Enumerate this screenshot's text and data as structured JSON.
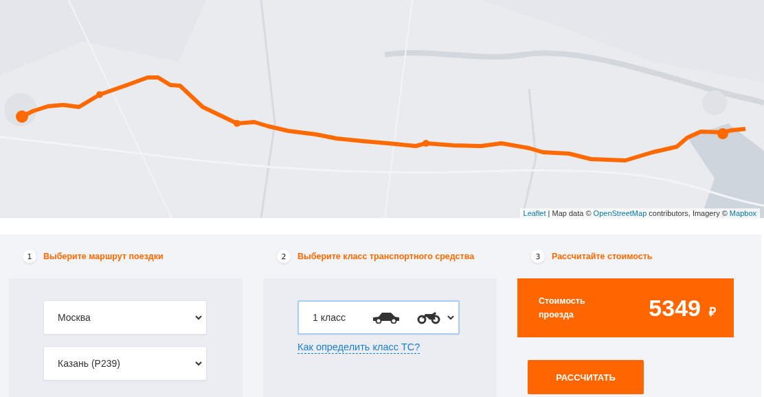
{
  "map": {
    "kind": "picture",
    "attribution": [
      {
        "text": "Leaflet",
        "link": true
      },
      {
        "text": " | Map data © ",
        "link": false
      },
      {
        "text": "OpenStreetMap",
        "link": true
      },
      {
        "text": " contributors, Imagery © ",
        "link": false
      },
      {
        "text": "Mapbox",
        "link": true
      }
    ]
  },
  "steps": [
    {
      "number": "1",
      "title": "Выберите маршрут поездки",
      "kind": "route",
      "fields": [
        {
          "value": "Москва"
        },
        {
          "value": "Казань (Р239)"
        }
      ]
    },
    {
      "number": "2",
      "title": "Выберите класс транспортного средства",
      "kind": "vehicle",
      "field": {
        "value": "1 класс",
        "focused": true
      },
      "link": "Как определить класс ТС?"
    },
    {
      "number": "3",
      "title": "Рассчитайте стоимость",
      "kind": "result",
      "cost_label": "Стоимость проезда",
      "cost": "5349",
      "currency": "₽",
      "button": "РАССЧИТАТЬ"
    }
  ]
}
